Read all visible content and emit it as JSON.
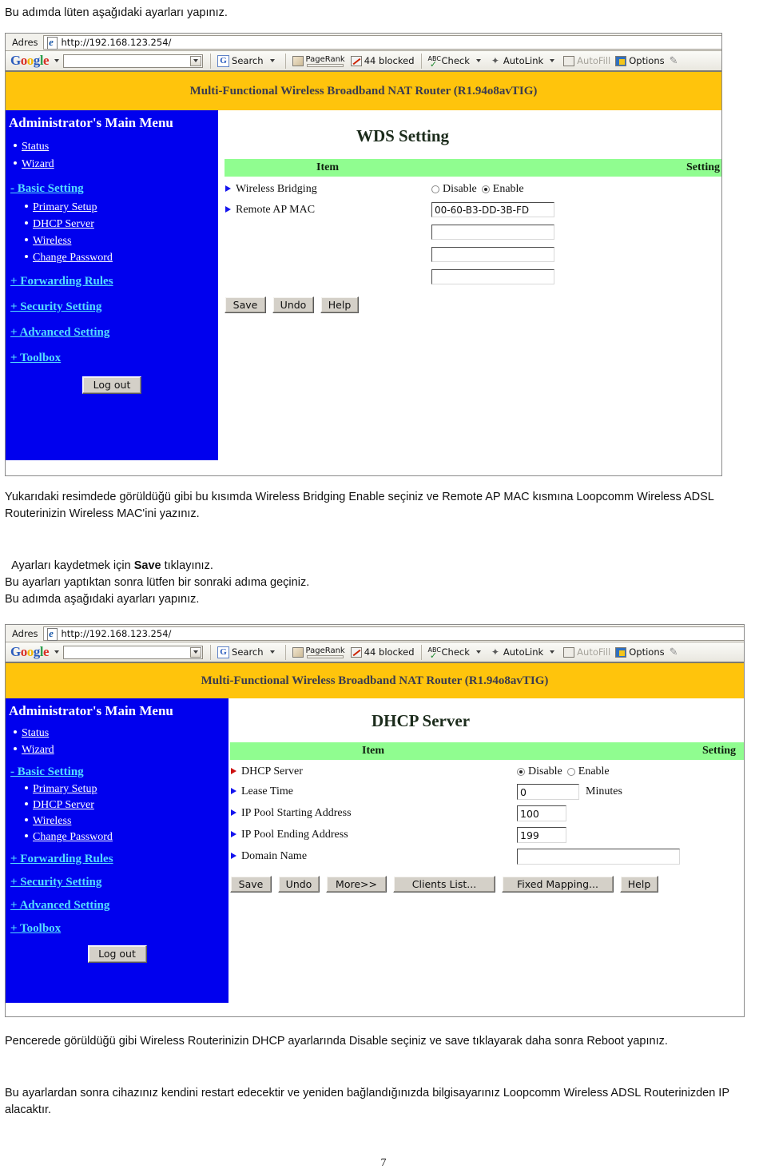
{
  "document": {
    "intro_line": "Bu adımda lüten aşağıdaki ayarları yapınız.",
    "mid_paragraph_1": "Yukarıdaki resimdede görüldüğü gibi bu kısımda Wireless Bridging Enable seçiniz ve Remote AP MAC kısmına Loopcomm Wireless ADSL Routerinizin Wireless MAC'ini yazınız.",
    "mid_paragraph_2_pre": "Ayarları kaydetmek için ",
    "mid_paragraph_2_bold": "Save",
    "mid_paragraph_2_post": " tıklayınız.",
    "mid_paragraph_3": "Bu ayarları yaptıktan sonra lütfen bir sonraki adıma geçiniz.\nBu adımda aşağıdaki ayarları yapınız.",
    "bottom_paragraph_1": "Pencerede görüldüğü gibi Wireless Routerinizin DHCP ayarlarında Disable seçiniz ve save tıklayarak daha sonra Reboot yapınız.",
    "bottom_paragraph_2": "Bu ayarlardan sonra cihazınız kendini restart edecektir ve yeniden bağlandığınızda bilgisayarınız Loopcomm Wireless ADSL Routerinizden IP alacaktır.",
    "page_number": "7"
  },
  "browser": {
    "address_label": "Adres",
    "address_url": "http://192.168.123.254/",
    "google_logo": {
      "g1": "G",
      "o1": "o",
      "o2": "o",
      "g2": "g",
      "l": "l",
      "e": "e"
    },
    "toolbar": {
      "search_label": "Search",
      "pagerank_label": "PageRank",
      "blocked_label": "44 blocked",
      "check_label": "Check",
      "autolink_label": "AutoLink",
      "autofill_label": "AutoFill",
      "options_label": "Options",
      "abc_label": "ABC"
    }
  },
  "router": {
    "banner": "Multi-Functional Wireless Broadband NAT Router (R1.94o8avTIG)",
    "sidebar": {
      "title": "Administrator's Main Menu",
      "items": [
        {
          "label": "Status",
          "kind": "bullet"
        },
        {
          "label": "Wizard",
          "kind": "bullet"
        },
        {
          "label": "- Basic Setting",
          "kind": "group"
        },
        {
          "label": "Primary Setup",
          "kind": "sub"
        },
        {
          "label": "DHCP Server",
          "kind": "sub"
        },
        {
          "label": "Wireless",
          "kind": "sub"
        },
        {
          "label": "Change Password",
          "kind": "sub"
        },
        {
          "label": "+ Forwarding Rules",
          "kind": "group"
        },
        {
          "label": "+ Security Setting",
          "kind": "group"
        },
        {
          "label": "+ Advanced Setting",
          "kind": "group"
        },
        {
          "label": "+ Toolbox",
          "kind": "group"
        }
      ],
      "logout_label": "Log out"
    },
    "colors": {
      "banner_yellow": "#ffc40c",
      "sidebar_blue": "#0000ee",
      "table_header_green": "#90fd90",
      "group_link_cyan": "#55ddff"
    }
  },
  "wds_panel": {
    "title": "WDS Setting",
    "columns": {
      "item": "Item",
      "setting": "Setting"
    },
    "rows": [
      {
        "label": "Wireless Bridging",
        "type": "radio",
        "options": [
          {
            "label": "Disable",
            "selected": false
          },
          {
            "label": "Enable",
            "selected": true
          }
        ]
      },
      {
        "label": "Remote AP MAC",
        "type": "text",
        "values": [
          "00-60-B3-DD-3B-FD",
          "",
          "",
          ""
        ]
      }
    ],
    "buttons": [
      "Save",
      "Undo",
      "Help"
    ]
  },
  "dhcp_panel": {
    "title": "DHCP Server",
    "columns": {
      "item": "Item",
      "setting": "Setting"
    },
    "rows": [
      {
        "label": "DHCP Server",
        "type": "radio",
        "options": [
          {
            "label": "Disable",
            "selected": true
          },
          {
            "label": "Enable",
            "selected": false
          }
        ]
      },
      {
        "label": "Lease Time",
        "type": "text",
        "value": "0",
        "unit": "Minutes"
      },
      {
        "label": "IP Pool Starting Address",
        "type": "text",
        "value": "100",
        "unit": ""
      },
      {
        "label": "IP Pool Ending Address",
        "type": "text",
        "value": "199",
        "unit": ""
      },
      {
        "label": "Domain Name",
        "type": "text",
        "value": "",
        "unit": ""
      }
    ],
    "buttons": [
      "Save",
      "Undo",
      "More>>",
      "Clients List...",
      "Fixed Mapping...",
      "Help"
    ]
  }
}
